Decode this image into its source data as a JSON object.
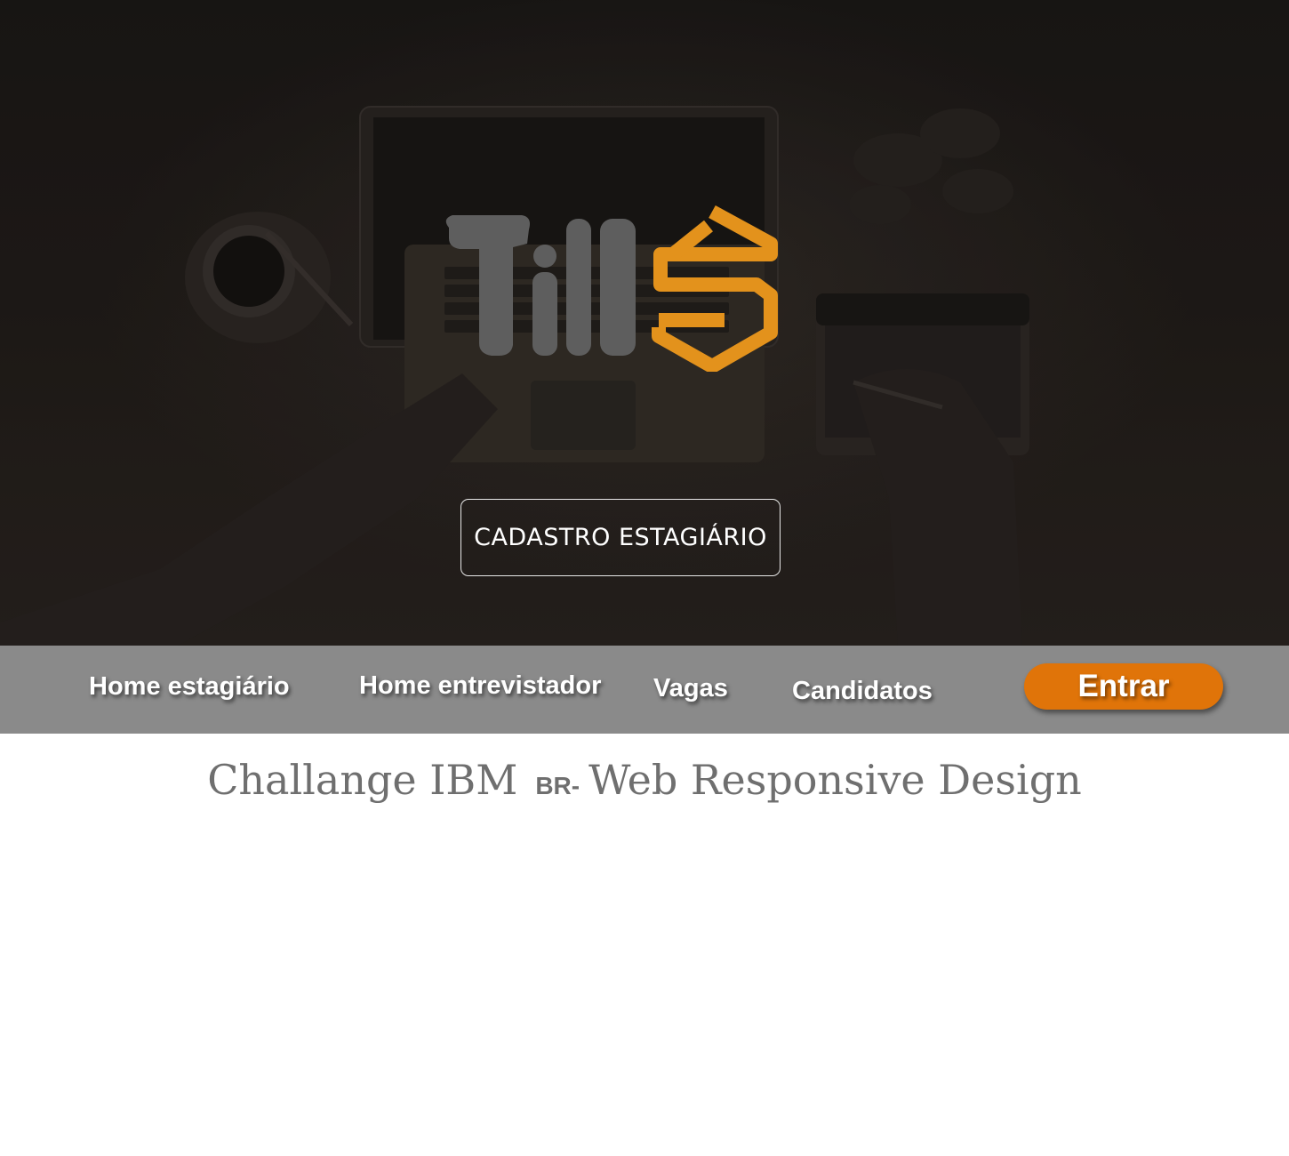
{
  "hero": {
    "cta_label": "CADASTRO ESTAGIÁRIO"
  },
  "logo": {
    "text": "Till S",
    "colors": {
      "gray": "#5e5e5e",
      "orange": "#e3921c"
    }
  },
  "nav": {
    "items": [
      {
        "label": "Home estagiário"
      },
      {
        "label": "Home entrevistador"
      },
      {
        "label": "Vagas"
      },
      {
        "label": "Candidatos"
      }
    ],
    "login_label": "Entrar",
    "accent": "#e07409"
  },
  "footer": {
    "title_part1": "Challange IBM",
    "title_part2": "BR-",
    "title_part3": "Web Responsive Design"
  }
}
